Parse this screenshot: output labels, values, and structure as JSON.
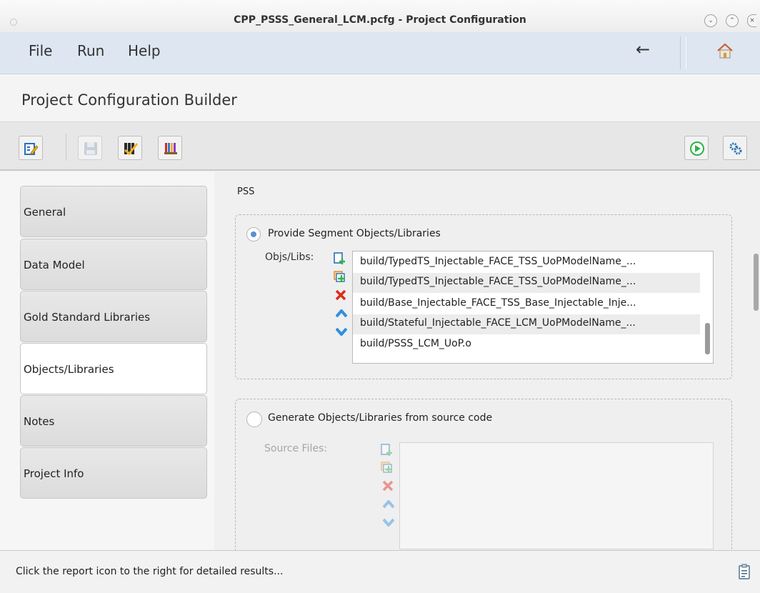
{
  "window": {
    "title": "CPP_PSSS_General_LCM.pcfg - Project Configuration"
  },
  "menubar": {
    "items": [
      "File",
      "Run",
      "Help"
    ],
    "back_icon": "back-arrow-icon",
    "home_icon": "home-icon"
  },
  "header": {
    "title": "Project Configuration Builder"
  },
  "toolbar": {
    "left": [
      "edit-config-icon",
      "save-icon",
      "validate-icon",
      "books-icon"
    ],
    "right": [
      "run-icon",
      "settings-gear-icon"
    ]
  },
  "nav": {
    "items": [
      "General",
      "Data Model",
      "Gold Standard Libraries",
      "Objects/Libraries",
      "Notes",
      "Project Info"
    ],
    "active": "Objects/Libraries"
  },
  "main": {
    "section_label": "PSS",
    "provide": {
      "radio_label": "Provide Segment Objects/Libraries",
      "selected": true,
      "field_label": "Objs/Libs:",
      "items": [
        "build/TypedTS_Injectable_FACE_TSS_UoPModelName_...",
        "build/TypedTS_Injectable_FACE_TSS_UoPModelName_...",
        "build/Base_Injectable_FACE_TSS_Base_Injectable_Inje...",
        "build/Stateful_Injectable_FACE_LCM_UoPModelName_...",
        "build/PSSS_LCM_UoP.o"
      ],
      "actions": [
        "add-icon",
        "add-multiple-icon",
        "remove-icon",
        "move-up-icon",
        "move-down-icon"
      ]
    },
    "generate": {
      "radio_label": "Generate Objects/Libraries from source code",
      "selected": false,
      "field_label": "Source Files:"
    }
  },
  "status": {
    "text": "Click the report icon to the right for detailed results...",
    "icon": "report-icon"
  },
  "colors": {
    "menubar_bg": "#dde6f1",
    "accent_green": "#2fb34a",
    "radio_blue": "#5a8fd4",
    "remove_red": "#e02a1a",
    "arrow_blue": "#2f8fe0"
  }
}
